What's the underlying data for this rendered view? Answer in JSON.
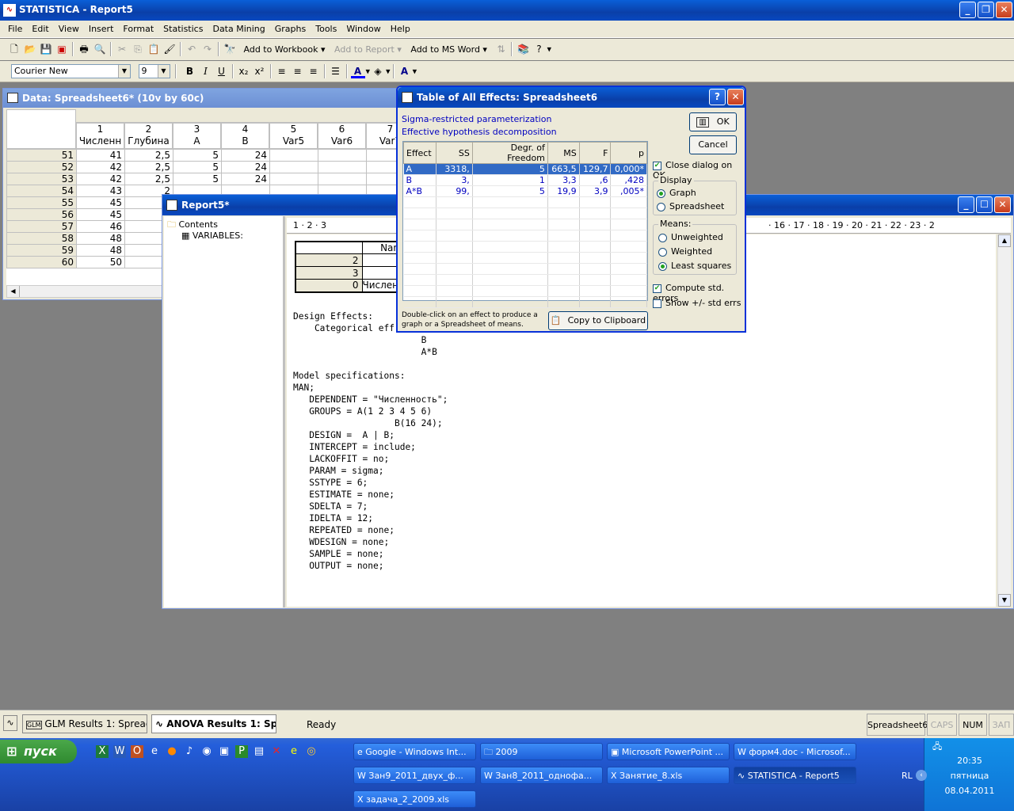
{
  "app": {
    "title": "STATISTICA - Report5"
  },
  "menu": [
    "File",
    "Edit",
    "View",
    "Insert",
    "Format",
    "Statistics",
    "Data Mining",
    "Graphs",
    "Tools",
    "Window",
    "Help"
  ],
  "toolbar": {
    "add_workbook": "Add to Workbook",
    "add_report": "Add to Report",
    "add_word": "Add to MS Word",
    "font": "Courier New",
    "size": "9"
  },
  "spreadsheet": {
    "title": "Data: Spreadsheet6* (10v by 60c)",
    "columns": [
      {
        "n": "1",
        "name": "Численн"
      },
      {
        "n": "2",
        "name": "Глубина"
      },
      {
        "n": "3",
        "name": "A"
      },
      {
        "n": "4",
        "name": "B"
      },
      {
        "n": "5",
        "name": "Var5"
      },
      {
        "n": "6",
        "name": "Var6"
      },
      {
        "n": "7",
        "name": "Var7"
      }
    ],
    "rows": [
      [
        "51",
        "41",
        "2,5",
        "5",
        "24"
      ],
      [
        "52",
        "42",
        "2,5",
        "5",
        "24"
      ],
      [
        "53",
        "42",
        "2,5",
        "5",
        "24"
      ],
      [
        "54",
        "43",
        "2",
        ""
      ],
      [
        "55",
        "45",
        "2",
        ""
      ],
      [
        "56",
        "45",
        ""
      ],
      [
        "57",
        "46",
        ""
      ],
      [
        "58",
        "48",
        ""
      ],
      [
        "59",
        "48",
        ""
      ],
      [
        "60",
        "50",
        ""
      ]
    ]
  },
  "report": {
    "title": "Report5*",
    "tree": {
      "root": "Contents",
      "child": "VARIABLES:"
    },
    "ruler_left": "1 · 2 · 3",
    "ruler_right": "· 16 · 17 · 18 · 19 · 20 · 21 · 22 · 23 · 2",
    "mini_table": {
      "header": "Nan",
      "rows": [
        {
          "id": "2",
          "v": ""
        },
        {
          "id": "3",
          "v": ""
        },
        {
          "id": "0",
          "v": "Числен"
        }
      ]
    },
    "text": "Design Effects:\n    Categorical eff\n                        B\n                        A*B\n\nModel specifications:\nMAN;\n   DEPENDENT = \"Численность\";\n   GROUPS = A(1 2 3 4 5 6)\n                   B(16 24);\n   DESIGN =  A | B;\n   INTERCEPT = include;\n   LACKOFFIT = no;\n   PARAM = sigma;\n   SSTYPE = 6;\n   ESTIMATE = none;\n   SDELTA = 7;\n   IDELTA = 12;\n   REPEATED = none;\n   WDESIGN = none;\n   SAMPLE = none;\n   OUTPUT = none;"
  },
  "dialog": {
    "title": "Table of All Effects: Spreadsheet6",
    "info1": "Sigma-restricted parameterization",
    "info2": "Effective hypothesis decomposition",
    "columns": [
      "Effect",
      "SS",
      "Degr. of Freedom",
      "MS",
      "F",
      "p"
    ],
    "rows": [
      [
        "A",
        "3318,",
        "5",
        "663,5",
        "129,7",
        "0,000*"
      ],
      [
        "B",
        "3,",
        "1",
        "3,3",
        ",6",
        ",428"
      ],
      [
        "A*B",
        "99,",
        "5",
        "19,9",
        "3,9",
        ",005*"
      ]
    ],
    "ok": "OK",
    "cancel": "Cancel",
    "close_on_ok": "Close dialog on OK",
    "display_label": "Display",
    "graph": "Graph",
    "spreadsheet": "Spreadsheet",
    "means_label": "Means:",
    "unweighted": "Unweighted",
    "weighted": "Weighted",
    "least_squares": "Least squares",
    "compute_std": "Compute std. errors",
    "show_std": "Show +/- std errs",
    "hint": "Double-click on an effect to produce a graph or a Spreadsheet of means.",
    "copy": "Copy to Clipboard"
  },
  "workbook_tabs": [
    "GLM Results 1: Spreadshe...",
    "ANOVA Results 1: Sp..."
  ],
  "status": {
    "ready": "Ready",
    "doc": "Spreadsheet6",
    "caps": "CAPS",
    "num": "NUM",
    "zap": "ЗАП"
  },
  "taskbar": {
    "start": "пуск",
    "tasks": [
      "Google - Windows Int...",
      "2009",
      "Microsoft PowerPoint ...",
      "форм4.doc - Microsof...",
      "Зан9_2011_двух_ф...",
      "Зан8_2011_однофа...",
      "Занятие_8.xls",
      "STATISTICA - Report5",
      "задача_2_2009.xls"
    ],
    "lang": "RL",
    "time": "20:35",
    "day": "пятница",
    "date": "08.04.2011"
  }
}
